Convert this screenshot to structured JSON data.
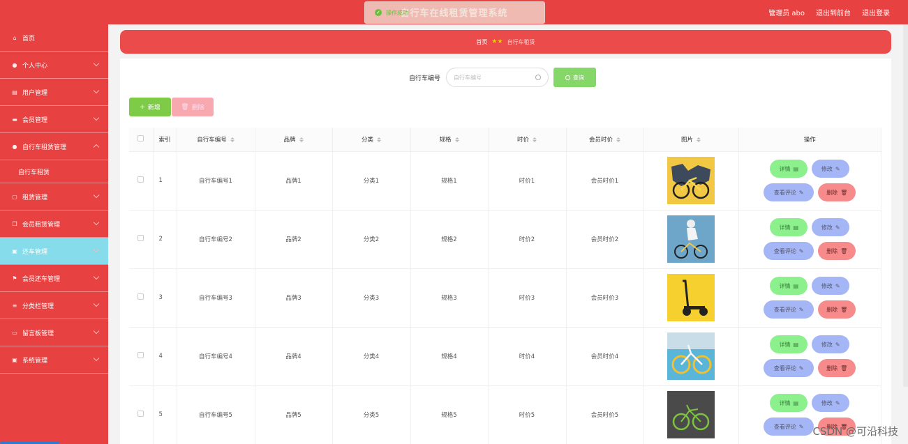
{
  "header": {
    "title": "自行车在线租赁管理系统",
    "user": "管理员 abo",
    "back_front": "退出到前台",
    "logout": "退出登录"
  },
  "toast": {
    "text": "操作成功"
  },
  "sidebar": {
    "items": [
      {
        "label": "首页",
        "icon": "home-icon"
      },
      {
        "label": "个人中心",
        "icon": "user-icon"
      },
      {
        "label": "用户管理",
        "icon": "briefcase-icon"
      },
      {
        "label": "会员管理",
        "icon": "printer-icon"
      },
      {
        "label": "自行车租赁管理",
        "icon": "user-icon"
      },
      {
        "label": "自行车租赁",
        "icon": ""
      },
      {
        "label": "租赁管理",
        "icon": "document-icon"
      },
      {
        "label": "会员租赁管理",
        "icon": "copy-icon"
      },
      {
        "label": "还车管理",
        "icon": "clipboard-icon"
      },
      {
        "label": "会员还车管理",
        "icon": "flag-icon"
      },
      {
        "label": "分类栏管理",
        "icon": "list-icon"
      },
      {
        "label": "留言板管理",
        "icon": "monitor-icon"
      },
      {
        "label": "系统管理",
        "icon": "clipboard-icon"
      }
    ]
  },
  "breadcrumb": {
    "home": "首页",
    "current": "自行车租赁"
  },
  "search": {
    "label": "自行车编号",
    "placeholder": "自行车编号",
    "query_label": "查询"
  },
  "toolbar": {
    "add_label": "新增",
    "delete_label": "删除"
  },
  "table": {
    "columns": [
      "索引",
      "自行车编号",
      "品牌",
      "分类",
      "规格",
      "时价",
      "会员时价",
      "图片",
      "操作"
    ],
    "rows": [
      {
        "index": "1",
        "code": "自行车编号1",
        "brand": "品牌1",
        "category": "分类1",
        "spec": "规格1",
        "price": "时价1",
        "member_price": "会员时价1"
      },
      {
        "index": "2",
        "code": "自行车编号2",
        "brand": "品牌2",
        "category": "分类2",
        "spec": "规格2",
        "price": "时价2",
        "member_price": "会员时价2"
      },
      {
        "index": "3",
        "code": "自行车编号3",
        "brand": "品牌3",
        "category": "分类3",
        "spec": "规格3",
        "price": "时价3",
        "member_price": "会员时价3"
      },
      {
        "index": "4",
        "code": "自行车编号4",
        "brand": "品牌4",
        "category": "分类4",
        "spec": "规格4",
        "price": "时价4",
        "member_price": "会员时价4"
      },
      {
        "index": "5",
        "code": "自行车编号5",
        "brand": "品牌5",
        "category": "分类5",
        "spec": "规格5",
        "price": "时价5",
        "member_price": "会员时价5"
      }
    ],
    "actions": {
      "detail": "详情",
      "edit": "修改",
      "view_comments": "查看评论",
      "delete": "删除"
    }
  },
  "watermark": "CSDN @可沿科技",
  "colors": {
    "primary": "#e84141",
    "active": "#86dcea",
    "success": "#85d868",
    "danger": "#f78a8a",
    "info": "#a4b6f5"
  }
}
